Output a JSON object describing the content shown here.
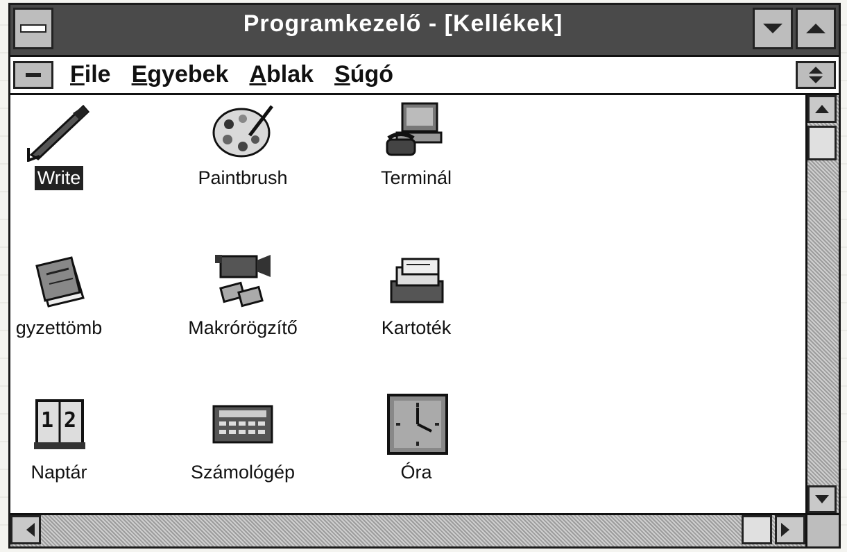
{
  "window": {
    "title": "Programkezelő - [Kellékek]"
  },
  "menubar": {
    "items": [
      {
        "mnemonic": "F",
        "rest": "ile"
      },
      {
        "mnemonic": "E",
        "rest": "gyebek"
      },
      {
        "mnemonic": "A",
        "rest": "blak"
      },
      {
        "mnemonic": "S",
        "rest": "úgó"
      }
    ]
  },
  "programs": [
    {
      "label": "Write",
      "icon": "write-pen-icon",
      "selected": true
    },
    {
      "label": "Paintbrush",
      "icon": "paint-palette-icon"
    },
    {
      "label": "Terminál",
      "icon": "terminal-phone-icon"
    },
    {
      "label": "gyzettömb",
      "icon": "notepad-icon"
    },
    {
      "label": "Makrórögzítő",
      "icon": "recorder-camera-icon"
    },
    {
      "label": "Kartoték",
      "icon": "cardfile-icon"
    },
    {
      "label": "Naptár",
      "icon": "calendar-icon"
    },
    {
      "label": "Számológép",
      "icon": "calculator-icon"
    },
    {
      "label": "Óra",
      "icon": "clock-icon"
    }
  ]
}
